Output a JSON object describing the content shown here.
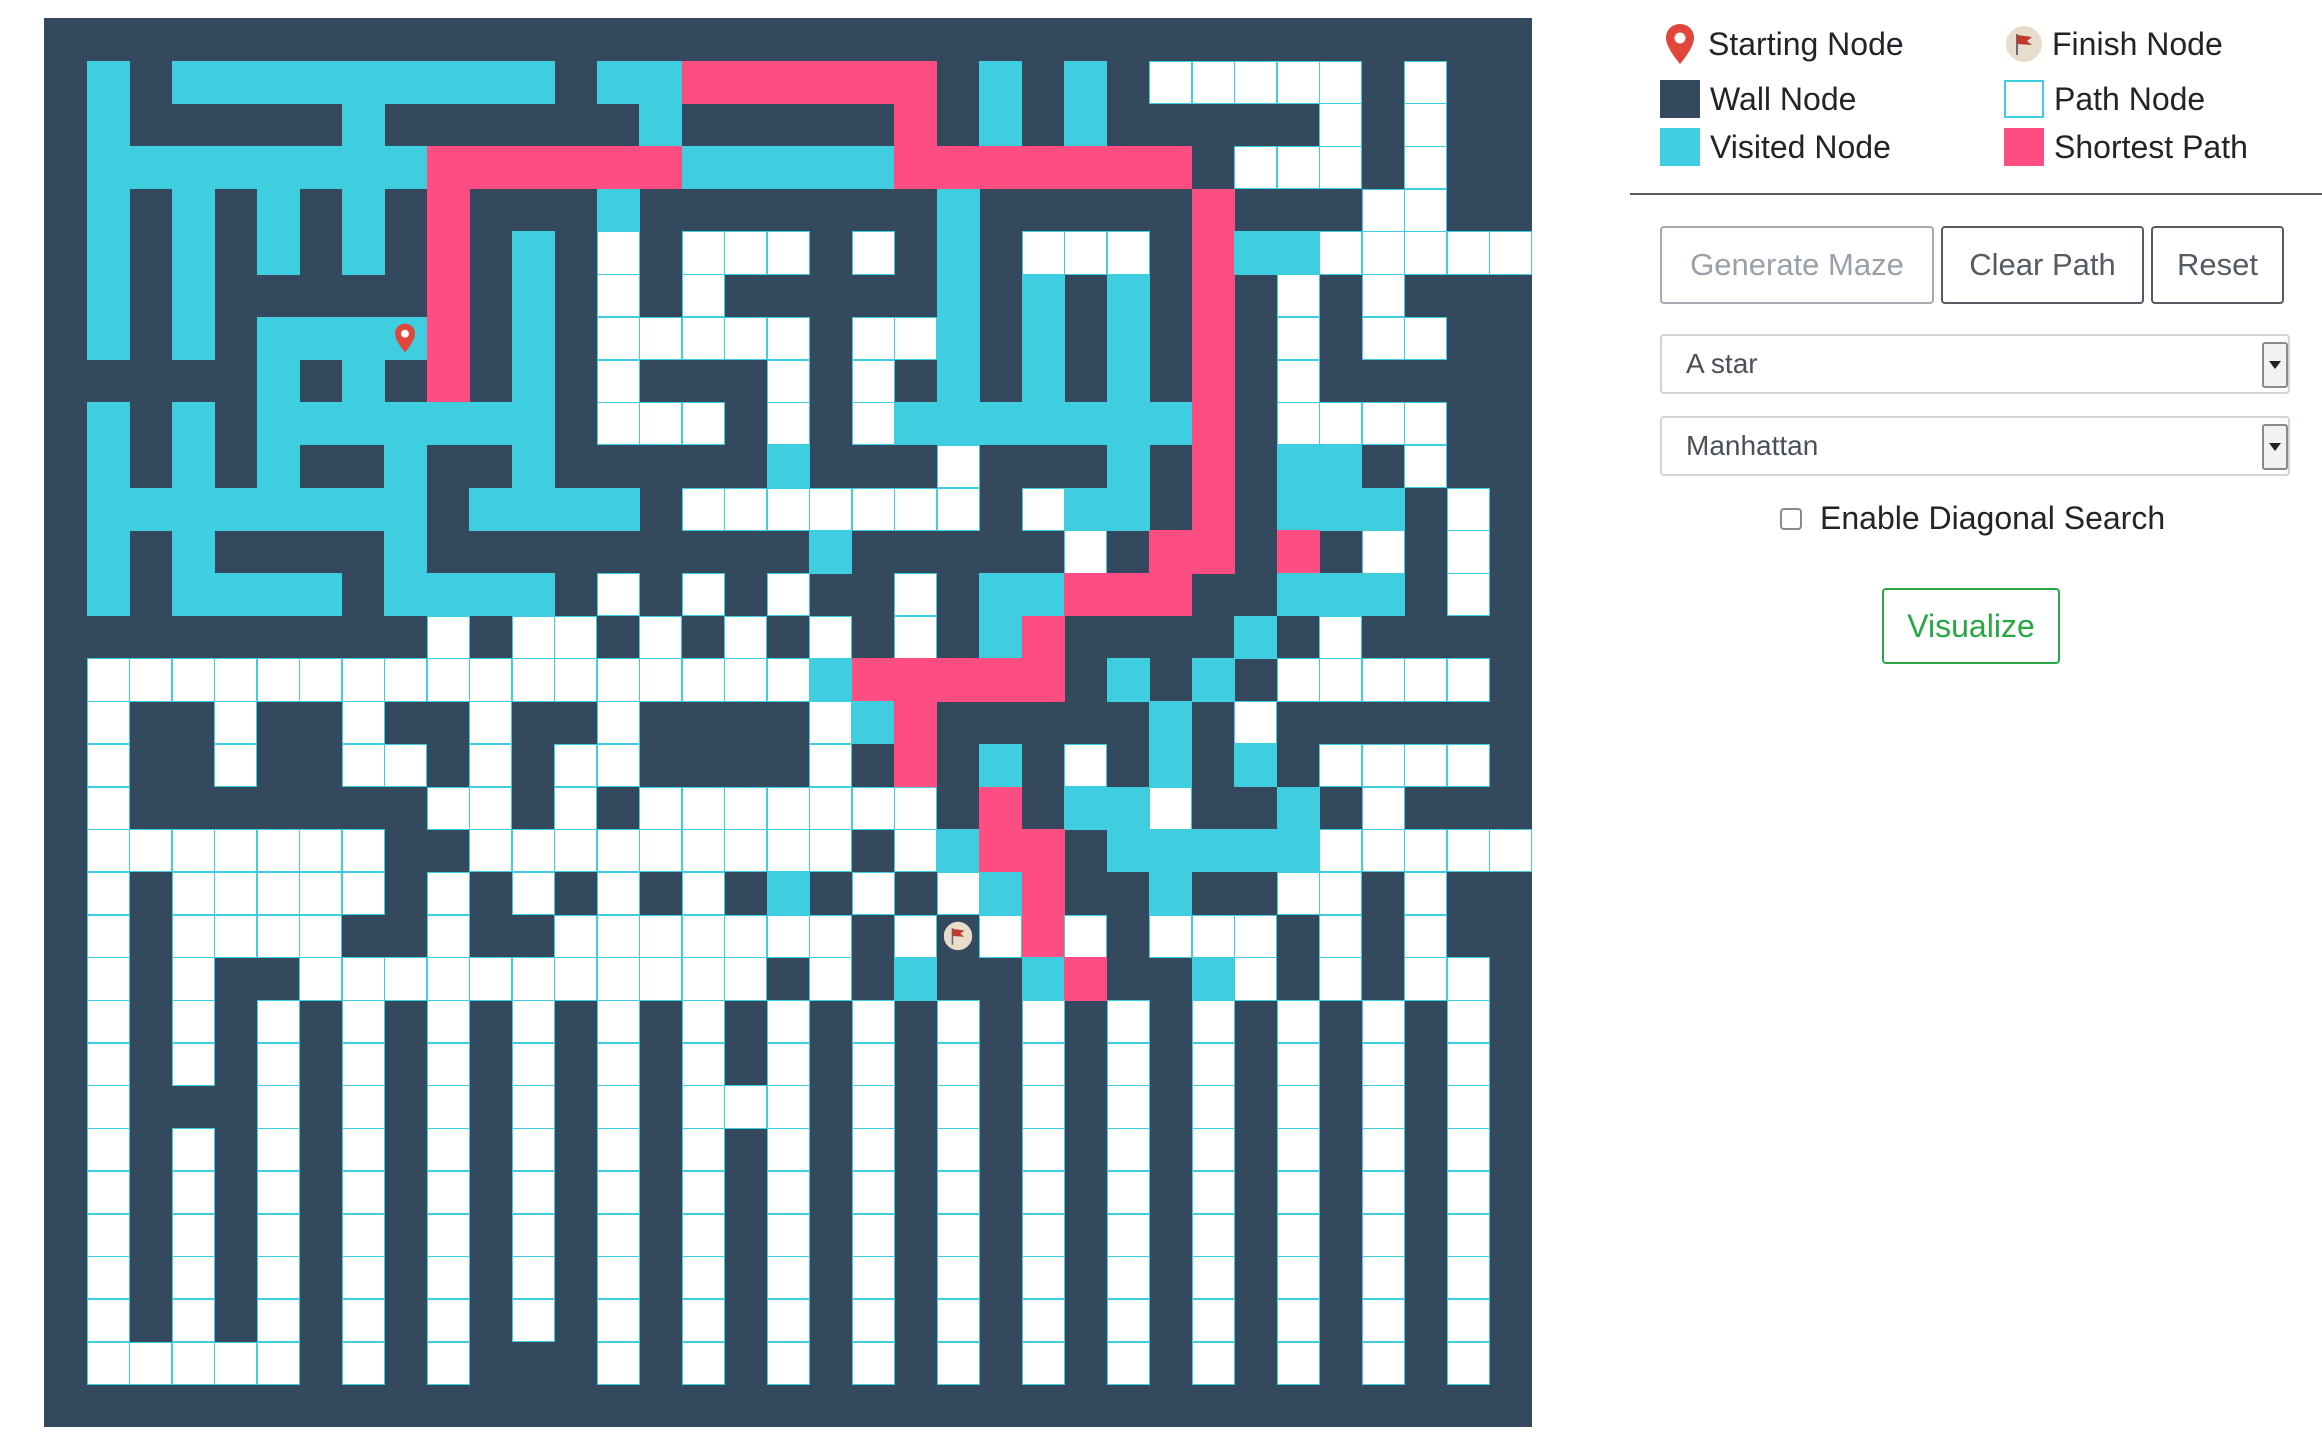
{
  "legend": {
    "start": "Starting Node",
    "finish": "Finish Node",
    "wall": "Wall Node",
    "path": "Path Node",
    "visited": "Visited Node",
    "shortest": "Shortest Path"
  },
  "buttons": {
    "generate": "Generate Maze",
    "clear": "Clear Path",
    "reset": "Reset",
    "visualize": "Visualize"
  },
  "algorithm": {
    "selected": "A star"
  },
  "heuristic": {
    "selected": "Manhattan"
  },
  "diagonal": {
    "label": "Enable Diagonal Search",
    "checked": false
  },
  "colors": {
    "wall": "#34495e",
    "path": "#ffffff",
    "path_border": "#3ecedf",
    "visited": "#3ecedf",
    "shortest": "#fd4d83",
    "start_marker": "#e0463a",
    "finish_marker": "#c0392b",
    "visualize": "#28a745"
  },
  "icons": {
    "start": "map-pin-icon",
    "finish": "flag-icon",
    "dropdown": "dropdown-arrow-icon"
  },
  "maze": {
    "rows": 33,
    "cols": 35,
    "start": [
      7,
      8
    ],
    "finish": [
      21,
      21
    ],
    "legend_codes": {
      "#": "wall",
      ".": "path",
      "v": "visited",
      "s": "shortest"
    },
    "grid": [
      "###################################",
      "#v#vvvvvvvvv#vvssssss#v#v#.....#.##",
      "#v#####v######v#####s#v#v#####.#.##",
      "#vvvvvvvvssssssvvvvvsssssss#...#.##",
      "#v#v#v#v#s###v#######v#####s###..##",
      "#v#v#v#v#s#v#.#...#.#v#...#svv.....",
      "#v#v#####s#v#.#.#####v#v#v#s#.#.###",
      "#v#v#vvvvs#v#.....#..v#v#v#s#.#..##",
      "#####v#v#s#v#.###.#.#v#v#v#s#.#####",
      "#v#v#vvvvvvv#...#.#.vvvvvvvs#....##",
      "#v#v#v##v##v#####v###.###v#s#vv#.##",
      "#vvvvvvvv#vvvv#.......#.vv#s#vvv#.#",
      "#v#v####v#########v#####.#ss#s#.#.#",
      "#v#vvvv#vvvv#.#.#.##.#vvsss##vvv#.#",
      "#########.#..#.#.#.#.#vs####v#.#####",
      "#.................vsssss#v#v#.....#",
      "#.##.##.##.##.####.vs#####v#.#####",
      "#.##.##..#.#..####.#s#v#.#v#v#....#",
      "#.#######..#.#.......#s#vv.##v#.##",
      "#.......##.........#.vss#vvvvv.....",
      "#.#.....#.#.#.#.#v#.#.vs##v##..#.##",
      "#.#....##.##.......#.#.s.#...#.#.##",
      "#.#.##...........#.#v##vs##v.#.#..#",
      "#.#.#.#.#.#.#.#.#.#.#.#.#.#.#.#.#.#",
      "#.#.#.#.#.#.#.#.#.#.#.#.#.#.#.#.#.#",
      "#.###.#.#.#.#.#...#.#.#.#.#.#.#.#.#",
      "#.#.#.#.#.#.#.#.#.#.#.#.#.#.#.#.#.#",
      "#.#.#.#.#.#.#.#.#.#.#.#.#.#.#.#.#.#",
      "#.#.#.#.#.#.#.#.#.#.#.#.#.#.#.#.#.#",
      "#.#.#.#.#.#.#.#.#.#.#.#.#.#.#.#.#.#",
      "#.#.#.#.#.#.#.#.#.#.#.#.#.#.#.#.#.#",
      "#.....#.#.###.#.#.#.#.#.#.#.#.#.#.#",
      "###################################"
    ]
  }
}
